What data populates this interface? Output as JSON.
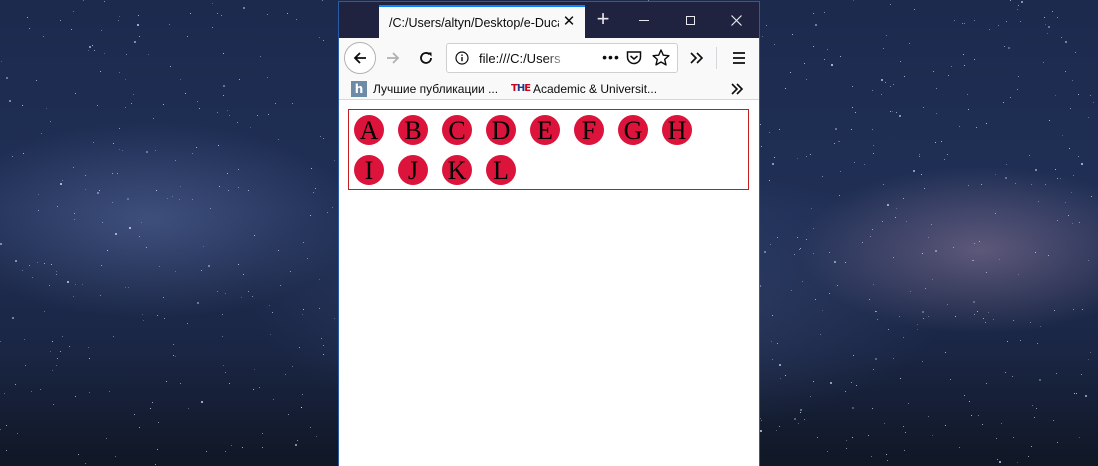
{
  "browser": {
    "tab_title": "/C:/Users/altyn/Desktop/e-Duca",
    "url": "file:///C:/Users",
    "bookmarks": [
      {
        "label": "Лучшие публикации ...",
        "icon": "h-site-icon"
      },
      {
        "label": "Academic & Universit...",
        "icon": "the-logo-icon"
      }
    ]
  },
  "page": {
    "letters": [
      "A",
      "B",
      "C",
      "D",
      "E",
      "F",
      "G",
      "H",
      "I",
      "J",
      "K",
      "L"
    ]
  },
  "colors": {
    "circle": "#dc143c",
    "box_border": "#c41e1e",
    "titlebar": "#202340",
    "tab_accent": "#0a84ff"
  }
}
